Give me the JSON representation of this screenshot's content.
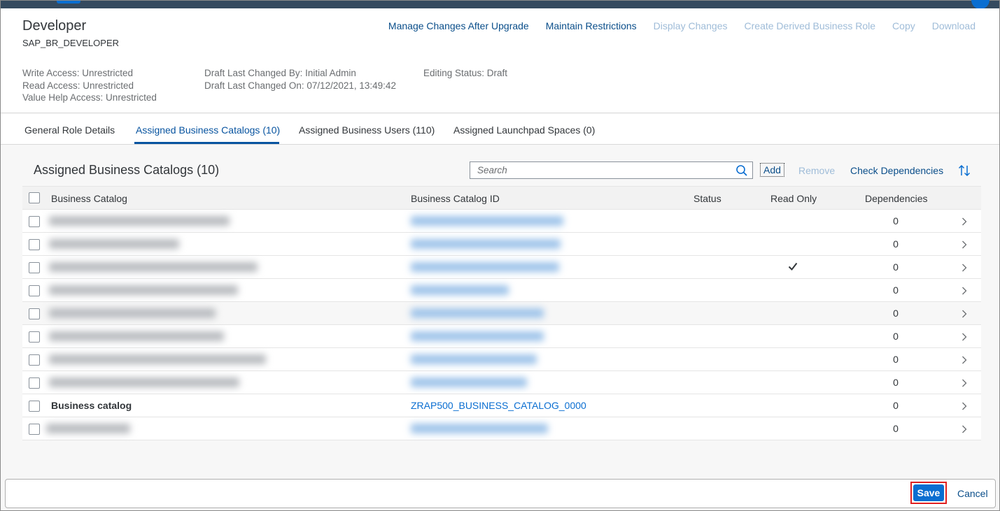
{
  "header": {
    "title": "Developer",
    "subtitle": "SAP_BR_DEVELOPER",
    "actions": [
      {
        "label": "Manage Changes After Upgrade",
        "enabled": true
      },
      {
        "label": "Maintain Restrictions",
        "enabled": true
      },
      {
        "label": "Display Changes",
        "enabled": false
      },
      {
        "label": "Create Derived Business Role",
        "enabled": false
      },
      {
        "label": "Copy",
        "enabled": false
      },
      {
        "label": "Download",
        "enabled": false
      }
    ],
    "access": {
      "write": "Write Access: Unrestricted",
      "read": "Read Access: Unrestricted",
      "value_help": "Value Help Access: Unrestricted"
    },
    "draft": {
      "changed_by": "Draft Last Changed By: Initial Admin",
      "changed_on": "Draft Last Changed On: 07/12/2021, 13:49:42"
    },
    "editing_status": "Editing Status: Draft"
  },
  "tabs": [
    {
      "label": "General Role Details",
      "active": false
    },
    {
      "label": "Assigned Business Catalogs (10)",
      "active": true
    },
    {
      "label": "Assigned Business Users (110)",
      "active": false
    },
    {
      "label": "Assigned Launchpad Spaces (0)",
      "active": false
    }
  ],
  "panel": {
    "title": "Assigned Business Catalogs (10)",
    "search_placeholder": "Search",
    "add_label": "Add",
    "remove_label": "Remove",
    "check_dependencies_label": "Check Dependencies"
  },
  "table": {
    "columns": [
      "Business Catalog",
      "Business Catalog ID",
      "Status",
      "Read Only",
      "Dependencies"
    ],
    "rows": [
      {
        "name": "",
        "id": "",
        "read_only": false,
        "dependencies": "0",
        "blurred": true
      },
      {
        "name": "",
        "id": "",
        "read_only": false,
        "dependencies": "0",
        "blurred": true
      },
      {
        "name": "",
        "id": "",
        "read_only": true,
        "dependencies": "0",
        "blurred": true
      },
      {
        "name": "",
        "id": "",
        "read_only": false,
        "dependencies": "0",
        "blurred": true
      },
      {
        "name": "",
        "id": "",
        "read_only": false,
        "dependencies": "0",
        "blurred": true
      },
      {
        "name": "",
        "id": "",
        "read_only": false,
        "dependencies": "0",
        "blurred": true
      },
      {
        "name": "",
        "id": "",
        "read_only": false,
        "dependencies": "0",
        "blurred": true
      },
      {
        "name": "",
        "id": "",
        "read_only": false,
        "dependencies": "0",
        "blurred": true
      },
      {
        "name": "Business catalog",
        "id": "ZRAP500_BUSINESS_CATALOG_0000",
        "read_only": false,
        "dependencies": "0",
        "blurred": false
      },
      {
        "name": "",
        "id": "",
        "read_only": false,
        "dependencies": "0",
        "blurred": true
      }
    ]
  },
  "footer": {
    "save_label": "Save",
    "cancel_label": "Cancel"
  }
}
